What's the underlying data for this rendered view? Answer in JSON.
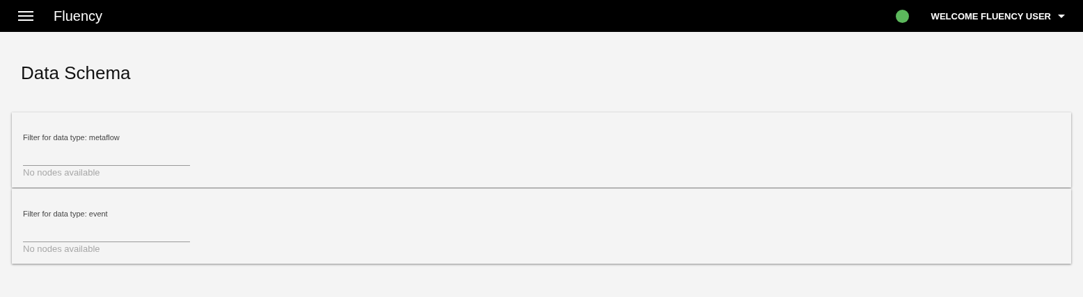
{
  "app_bar": {
    "title": "Fluency",
    "user_menu": "WELCOME FLUENCY USER"
  },
  "page_title": "Data Schema",
  "panels": [
    {
      "filter_label": "Filter for data type: metaflow",
      "message": "No nodes available"
    },
    {
      "filter_label": "Filter for data type: event",
      "message": "No nodes available"
    }
  ]
}
